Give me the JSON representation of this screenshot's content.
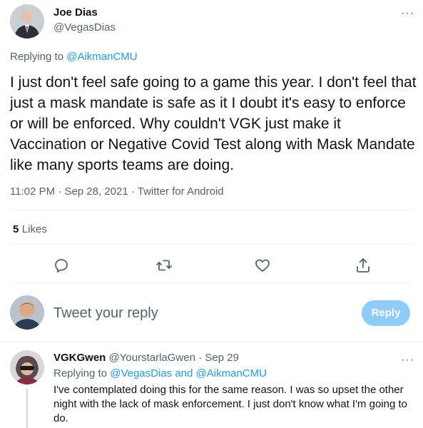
{
  "main_tweet": {
    "author_name": "Joe Dias",
    "author_handle": "@VegasDias",
    "more_label": "···",
    "replying_prefix": "Replying to",
    "replying_to": "@AikmanCMU",
    "text": "I just don't feel safe going to a game this year.  I don't feel that just a mask mandate is safe as it I doubt it's easy to enforce or will be enforced.  Why couldn't VGK just make it Vaccination or Negative Covid Test along with Mask Mandate like many sports teams are doing.",
    "time": "11:02 PM",
    "date": "Sep 28, 2021",
    "source": "Twitter for Android",
    "separator": "·",
    "likes_count": "5",
    "likes_label": "Likes"
  },
  "actions": {
    "icons": [
      "reply-icon",
      "retweet-icon",
      "like-icon",
      "share-icon"
    ]
  },
  "compose": {
    "placeholder": "Tweet your reply",
    "button_label": "Reply"
  },
  "reply_tweet": {
    "author_name": "VGKGwen",
    "author_handle": "@YourstarlaGwen",
    "separator": "·",
    "date": "Sep 29",
    "more_label": "···",
    "replying_prefix": "Replying to",
    "replying_to_1": "@VegasDias",
    "replying_and": "and",
    "replying_to_2": "@AikmanCMU",
    "text": "I've contemplated doing this for the same reason. I was so upset the other night with the lack of mask enforcement. I just don't know what I'm going to do."
  },
  "colors": {
    "accent": "#1d9bf0",
    "reply_button": "#8ecdf8",
    "secondary_text": "#536471"
  }
}
